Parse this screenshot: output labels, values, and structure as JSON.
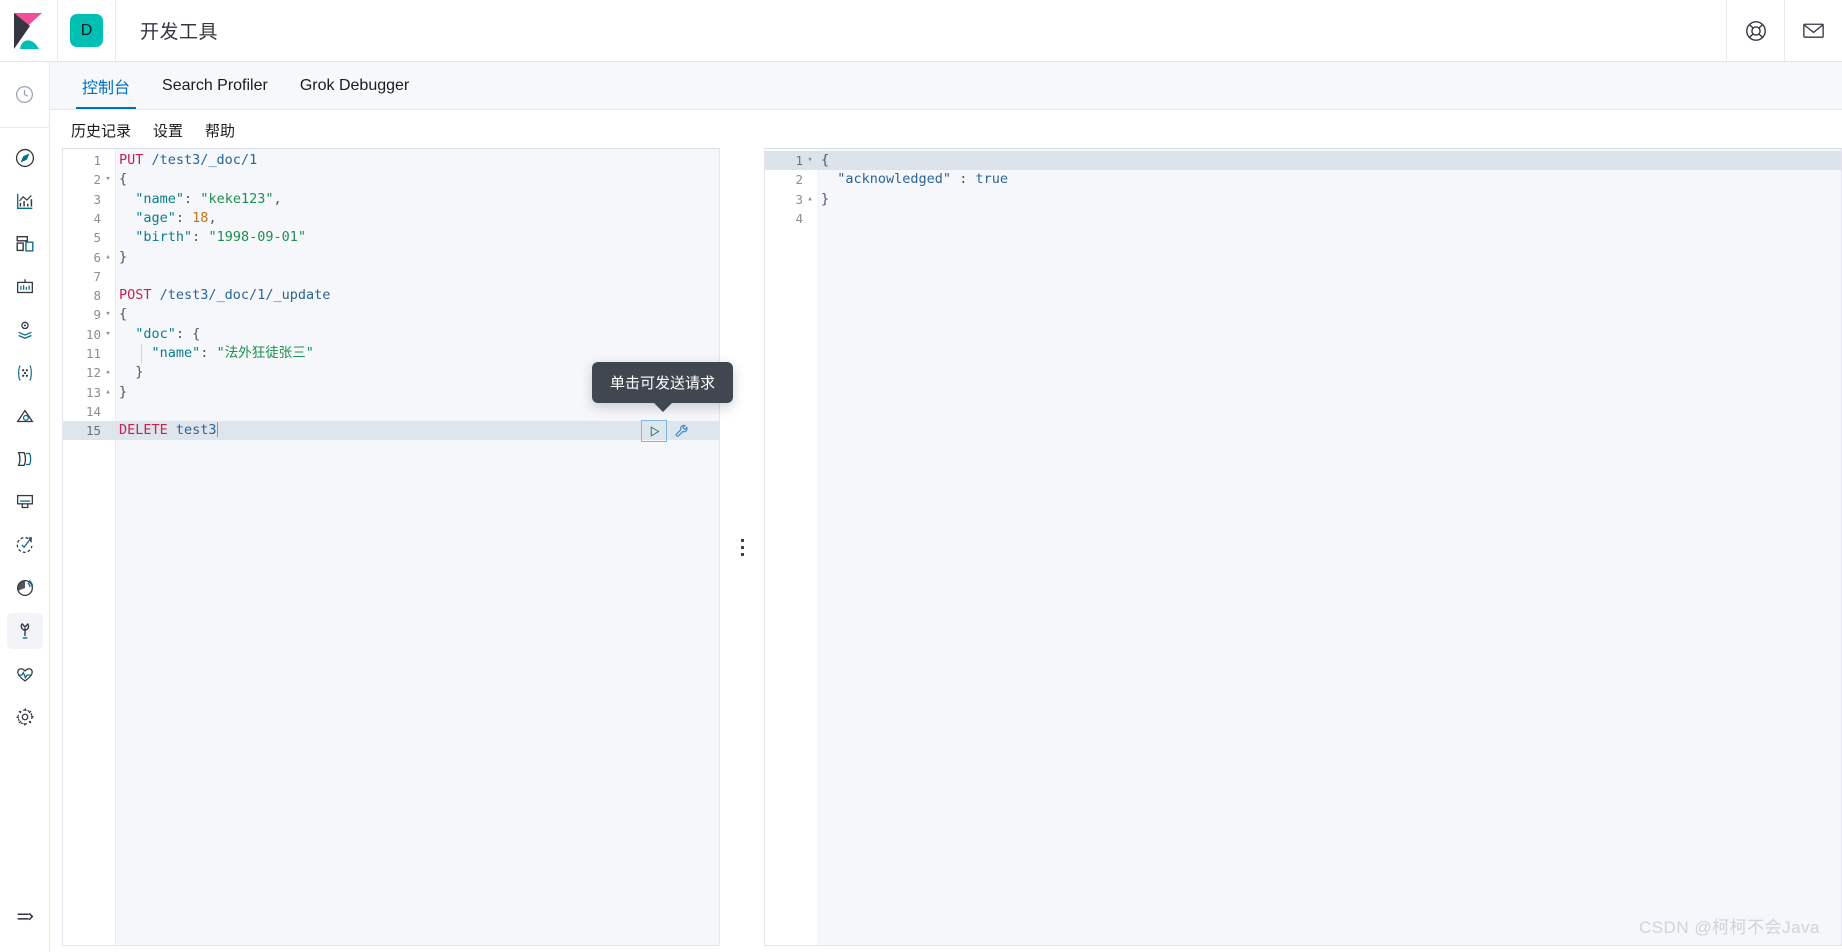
{
  "header": {
    "logo_name": "kibana-logo",
    "space_badge": "D",
    "title": "开发工具",
    "help_icon": "life-ring-icon",
    "mail_icon": "mail-icon"
  },
  "sidebar": {
    "items": [
      {
        "icon": "recently-viewed-clock-icon",
        "name": "recently-viewed"
      },
      {
        "icon": "compass-discover-icon",
        "name": "discover"
      },
      {
        "icon": "visualize-bar-chart-icon",
        "name": "visualize"
      },
      {
        "icon": "dashboard-grid-icon",
        "name": "dashboard"
      },
      {
        "icon": "canvas-presentation-icon",
        "name": "canvas"
      },
      {
        "icon": "maps-layers-pin-icon",
        "name": "maps"
      },
      {
        "icon": "machine-learning-nodes-icon",
        "name": "machine-learning"
      },
      {
        "icon": "infrastructure-metrics-icon",
        "name": "infrastructure"
      },
      {
        "icon": "logs-stack-icon",
        "name": "logs"
      },
      {
        "icon": "apm-monitor-icon",
        "name": "apm"
      },
      {
        "icon": "uptime-check-arrow-icon",
        "name": "uptime"
      },
      {
        "icon": "siem-radar-icon",
        "name": "siem"
      },
      {
        "icon": "dev-tools-wrench-icon",
        "name": "dev-tools",
        "active": true
      },
      {
        "icon": "stack-monitoring-heartbeat-icon",
        "name": "monitoring"
      },
      {
        "icon": "management-gear-icon",
        "name": "management"
      }
    ],
    "collapse_icon": "collapse-arrow-icon"
  },
  "tabs": [
    {
      "label": "控制台",
      "active": true
    },
    {
      "label": "Search Profiler",
      "active": false
    },
    {
      "label": "Grok Debugger",
      "active": false
    }
  ],
  "console_menu": [
    {
      "label": "历史记录"
    },
    {
      "label": "设置"
    },
    {
      "label": "帮助"
    }
  ],
  "editor": {
    "lines": [
      {
        "n": "1",
        "fold": "",
        "current": false,
        "tokens": [
          {
            "t": "PUT",
            "c": "t-method"
          },
          {
            "t": " ",
            "c": "t-plain"
          },
          {
            "t": "/test3/_doc/1",
            "c": "t-url"
          }
        ]
      },
      {
        "n": "2",
        "fold": "▾",
        "current": false,
        "tokens": [
          {
            "t": "{",
            "c": "t-punc"
          }
        ]
      },
      {
        "n": "3",
        "fold": "",
        "current": false,
        "tokens": [
          {
            "t": "  ",
            "c": "t-plain"
          },
          {
            "t": "\"name\"",
            "c": "t-key"
          },
          {
            "t": ": ",
            "c": "t-punc"
          },
          {
            "t": "\"keke123\"",
            "c": "t-str"
          },
          {
            "t": ",",
            "c": "t-punc"
          }
        ]
      },
      {
        "n": "4",
        "fold": "",
        "current": false,
        "tokens": [
          {
            "t": "  ",
            "c": "t-plain"
          },
          {
            "t": "\"age\"",
            "c": "t-key"
          },
          {
            "t": ": ",
            "c": "t-punc"
          },
          {
            "t": "18",
            "c": "t-num"
          },
          {
            "t": ",",
            "c": "t-punc"
          }
        ]
      },
      {
        "n": "5",
        "fold": "",
        "current": false,
        "tokens": [
          {
            "t": "  ",
            "c": "t-plain"
          },
          {
            "t": "\"birth\"",
            "c": "t-key"
          },
          {
            "t": ": ",
            "c": "t-punc"
          },
          {
            "t": "\"1998-09-01\"",
            "c": "t-str"
          }
        ]
      },
      {
        "n": "6",
        "fold": "▴",
        "current": false,
        "tokens": [
          {
            "t": "}",
            "c": "t-punc"
          }
        ]
      },
      {
        "n": "7",
        "fold": "",
        "current": false,
        "tokens": []
      },
      {
        "n": "8",
        "fold": "",
        "current": false,
        "tokens": [
          {
            "t": "POST",
            "c": "t-method"
          },
          {
            "t": " ",
            "c": "t-plain"
          },
          {
            "t": "/test3/_doc/1/_update",
            "c": "t-url"
          }
        ]
      },
      {
        "n": "9",
        "fold": "▾",
        "current": false,
        "tokens": [
          {
            "t": "{",
            "c": "t-punc"
          }
        ]
      },
      {
        "n": "10",
        "fold": "▾",
        "current": false,
        "tokens": [
          {
            "t": "  ",
            "c": "t-plain"
          },
          {
            "t": "\"doc\"",
            "c": "t-key"
          },
          {
            "t": ": ",
            "c": "t-punc"
          },
          {
            "t": "{",
            "c": "t-punc"
          }
        ]
      },
      {
        "n": "11",
        "fold": "",
        "current": false,
        "guide": true,
        "tokens": [
          {
            "t": "    ",
            "c": "t-plain"
          },
          {
            "t": "\"name\"",
            "c": "t-key"
          },
          {
            "t": ": ",
            "c": "t-punc"
          },
          {
            "t": "\"法外狂徒张三\"",
            "c": "t-str"
          }
        ]
      },
      {
        "n": "12",
        "fold": "▴",
        "current": false,
        "tokens": [
          {
            "t": "  ",
            "c": "t-plain"
          },
          {
            "t": "}",
            "c": "t-punc"
          }
        ]
      },
      {
        "n": "13",
        "fold": "▴",
        "current": false,
        "tokens": [
          {
            "t": "}",
            "c": "t-punc"
          }
        ]
      },
      {
        "n": "14",
        "fold": "",
        "current": false,
        "tokens": []
      },
      {
        "n": "15",
        "fold": "",
        "current": true,
        "caret": true,
        "tokens": [
          {
            "t": "DELETE",
            "c": "t-method"
          },
          {
            "t": " ",
            "c": "t-plain"
          },
          {
            "t": "test3",
            "c": "t-url"
          }
        ]
      }
    ],
    "tooltip_text": "单击可发送请求",
    "play_icon": "play-triangle-icon",
    "wrench_icon": "wrench-icon",
    "resizer_icon": "resize-handle-dots-icon"
  },
  "response": {
    "lines": [
      {
        "n": "1",
        "fold": "▾",
        "current": true,
        "tokens": [
          {
            "t": "{",
            "c": "t-punc"
          }
        ]
      },
      {
        "n": "2",
        "fold": "",
        "current": false,
        "tokens": [
          {
            "t": "  ",
            "c": "t-plain"
          },
          {
            "t": "\"acknowledged\"",
            "c": "t-resp-key"
          },
          {
            "t": " : ",
            "c": "t-punc"
          },
          {
            "t": "true",
            "c": "t-bool"
          }
        ]
      },
      {
        "n": "3",
        "fold": "▴",
        "current": false,
        "tokens": [
          {
            "t": "}",
            "c": "t-punc"
          }
        ]
      },
      {
        "n": "4",
        "fold": "",
        "current": false,
        "tokens": []
      }
    ]
  },
  "watermark": "CSDN @柯柯不会Java",
  "colors": {
    "accent_blue": "#0071c2",
    "teal": "#00bfb3",
    "pink": "#f04e98",
    "tooltip_bg": "#414750",
    "pane_bg": "#f5f7fa",
    "current_line": "#dfe5ed"
  }
}
